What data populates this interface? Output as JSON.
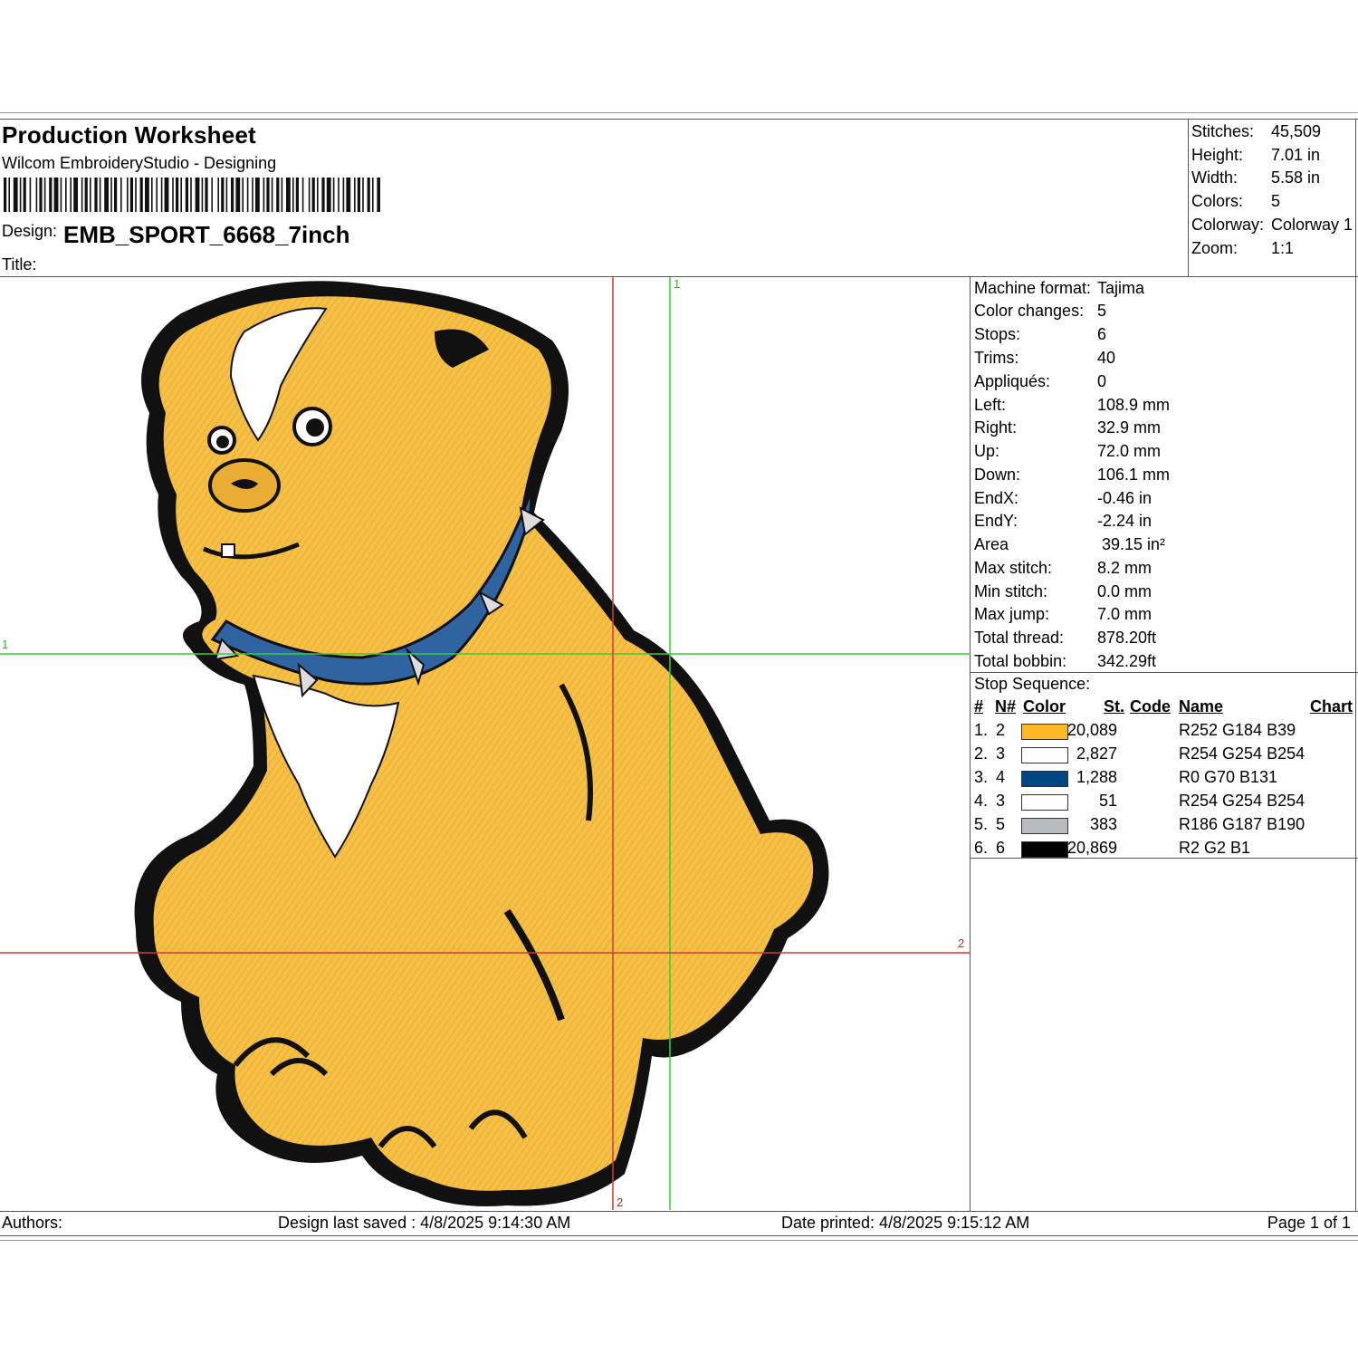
{
  "header": {
    "title": "Production Worksheet",
    "app": "Wilcom EmbroideryStudio - Designing",
    "design_label": "Design:",
    "design_value": "EMB_SPORT_6668_7inch",
    "title_label": "Title:"
  },
  "summary": [
    {
      "label": "Stitches:",
      "value": "45,509"
    },
    {
      "label": "Height:",
      "value": "7.01 in"
    },
    {
      "label": "Width:",
      "value": "5.58 in"
    },
    {
      "label": "Colors:",
      "value": "5"
    },
    {
      "label": "Colorway:",
      "value": "Colorway 1"
    },
    {
      "label": "Zoom:",
      "value": "1:1"
    }
  ],
  "stats": [
    {
      "label": "Machine format:",
      "value": "Tajima"
    },
    {
      "label": "Color changes:",
      "value": "5"
    },
    {
      "label": "Stops:",
      "value": "6"
    },
    {
      "label": "Trims:",
      "value": "40"
    },
    {
      "label": "Appliqués:",
      "value": "0"
    },
    {
      "label": "Left:",
      "value": "108.9 mm"
    },
    {
      "label": "Right:",
      "value": "32.9 mm"
    },
    {
      "label": "Up:",
      "value": "72.0 mm"
    },
    {
      "label": "Down:",
      "value": "106.1 mm"
    },
    {
      "label": "EndX:",
      "value": "-0.46 in"
    },
    {
      "label": "EndY:",
      "value": "-2.24 in"
    },
    {
      "label": "Area",
      "value": " 39.15 in²"
    },
    {
      "label": "Max stitch:",
      "value": "8.2 mm"
    },
    {
      "label": "Min stitch:",
      "value": "0.0 mm"
    },
    {
      "label": "Max jump:",
      "value": "7.0 mm"
    },
    {
      "label": "Total thread:",
      "value": "878.20ft"
    },
    {
      "label": "Total bobbin:",
      "value": "342.29ft"
    }
  ],
  "stop_sequence": {
    "title": "Stop Sequence:",
    "headers": {
      "idx": "#",
      "n": "N#",
      "color": "Color",
      "st": "St.",
      "code": "Code",
      "name": "Name",
      "chart": "Chart"
    },
    "rows": [
      {
        "idx": "1.",
        "n": "2",
        "color": "#FCB827",
        "stitches": "20,089",
        "name": "R252 G184 B39"
      },
      {
        "idx": "2.",
        "n": "3",
        "color": "#FEFEFE",
        "stitches": "2,827",
        "name": "R254 G254 B254"
      },
      {
        "idx": "3.",
        "n": "4",
        "color": "#004683",
        "stitches": "1,288",
        "name": "R0 G70 B131"
      },
      {
        "idx": "4.",
        "n": "3",
        "color": "#FEFEFE",
        "stitches": "51",
        "name": "R254 G254 B254"
      },
      {
        "idx": "5.",
        "n": "5",
        "color": "#BABBBE",
        "stitches": "383",
        "name": "R186 G187 B190"
      },
      {
        "idx": "6.",
        "n": "6",
        "color": "#020201",
        "stitches": "20,869",
        "name": "R2 G2 B1"
      }
    ]
  },
  "guides": {
    "green_v": "1",
    "green_h": "1",
    "red_h": "2",
    "red_v": "2"
  },
  "footer": {
    "authors": "Authors:",
    "saved": "Design last saved : 4/8/2025 9:14:30 AM",
    "printed": "Date printed: 4/8/2025 9:15:12 AM",
    "page": "Page 1 of 1"
  }
}
